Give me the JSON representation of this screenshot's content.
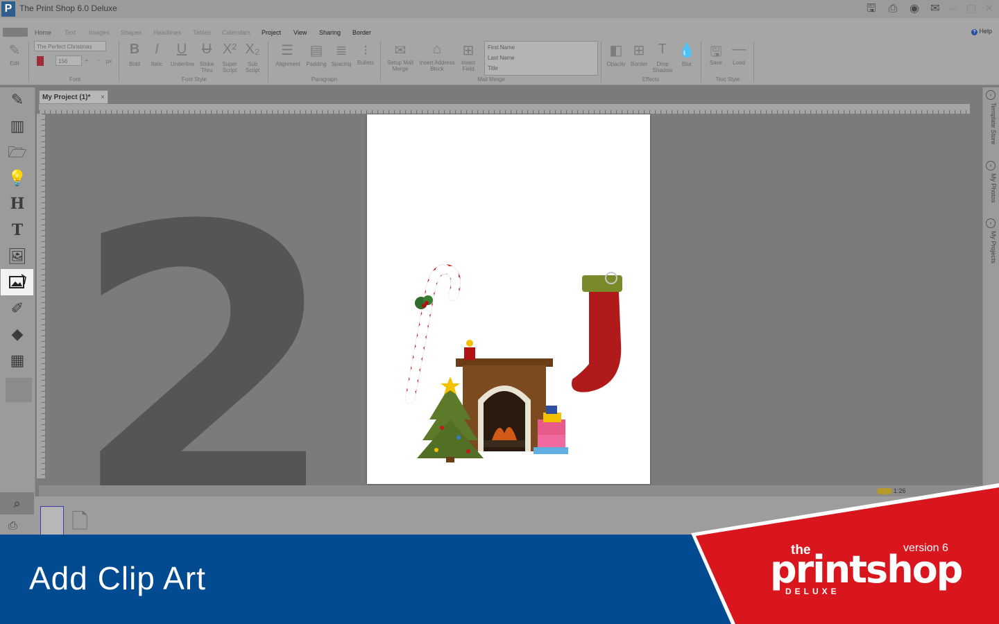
{
  "window": {
    "title": "The Print Shop 6.0 Deluxe",
    "logo_letter": "P"
  },
  "menu": {
    "tabs": [
      {
        "label": "Home",
        "state": "active"
      },
      {
        "label": "Text",
        "state": "dim"
      },
      {
        "label": "Images",
        "state": "dim"
      },
      {
        "label": "Shapes",
        "state": "dim"
      },
      {
        "label": "Headlines",
        "state": "dim"
      },
      {
        "label": "Tables",
        "state": "dim"
      },
      {
        "label": "Calendars",
        "state": "dim"
      },
      {
        "label": "Project",
        "state": "active"
      },
      {
        "label": "View",
        "state": "active"
      },
      {
        "label": "Sharing",
        "state": "active"
      },
      {
        "label": "Border",
        "state": "active"
      }
    ],
    "help": "Help"
  },
  "ribbon": {
    "edit_label": "Edit",
    "font_name": "The Perfect Christmas",
    "font_size": "156",
    "size_unit": "px",
    "font_group": "Font",
    "font_style": {
      "group": "Font Style",
      "bold": "Bold",
      "italic": "Italic",
      "underline": "Underline",
      "strike": "Strike Thru",
      "super": "Super Script",
      "sub": "Sub Script"
    },
    "paragraph": {
      "group": "Paragraph",
      "alignment": "Alignment",
      "padding": "Padding",
      "spacing": "Spacing",
      "bullets": "Bullets"
    },
    "mail_merge": {
      "group": "Mail Merge",
      "setup": "Setup Mail Merge",
      "insert_block": "Insert Address Block",
      "insert_field": "Insert Field",
      "fields": [
        "First Name",
        "Last Name",
        "Title"
      ]
    },
    "effects": {
      "group": "Effects",
      "opacity": "Opacity",
      "border": "Border",
      "drop_shadow": "Drop Shadow",
      "blur": "Blur"
    },
    "text_style": {
      "group": "Text Style",
      "save": "Save",
      "load": "Load"
    }
  },
  "document": {
    "tab_label": "My Project (1)*",
    "close": "×"
  },
  "step": {
    "number": "2",
    "caption": "Add Clip Art"
  },
  "side_panels": [
    "Template Store",
    "My Photos",
    "My Projects"
  ],
  "status": {
    "zoom": "1:26"
  },
  "brand": {
    "the": "the",
    "name": "printshop",
    "version": "version 6",
    "edition": "DELUXE"
  },
  "colors": {
    "banner_blue": "#024b91",
    "brand_red": "#d9151e"
  }
}
